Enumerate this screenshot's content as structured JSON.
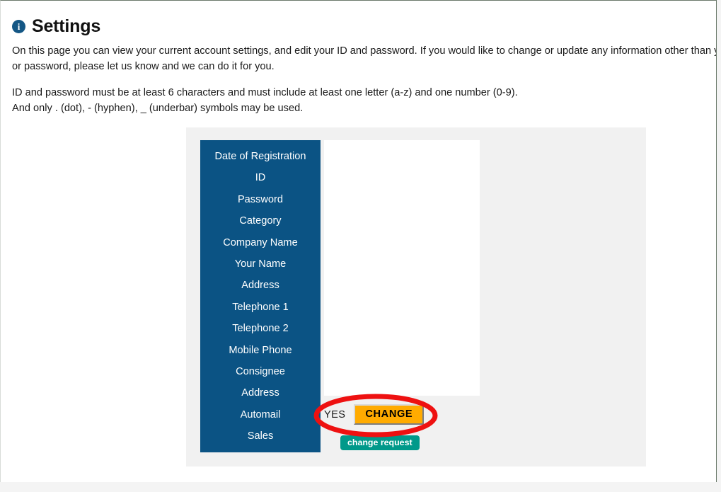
{
  "page": {
    "title": "Settings",
    "info_icon": "info-icon",
    "intro_line_1": "On this page you can view your current account settings, and edit your ID and password. If you would like to change or update any information other than you",
    "intro_line_2": "or password, please let us know and we can do it for you.",
    "rules_line_1": "ID and password must be at least 6 characters and must include at least one letter (a-z) and one number (0-9).",
    "rules_line_2": "And only . (dot), - (hyphen), _ (underbar) symbols may be used."
  },
  "settings_form": {
    "field_labels": [
      "Date of Registration",
      "ID",
      "Password",
      "Category",
      "Company Name",
      "Your Name",
      "Address",
      "Telephone 1",
      "Telephone 2",
      "Mobile Phone",
      "Consignee",
      "Address",
      "Automail",
      "Sales"
    ],
    "field_values": [
      "",
      "",
      "",
      "",
      "",
      "",
      "",
      "",
      "",
      "",
      "",
      "",
      "",
      ""
    ],
    "confirm_label": "YES",
    "change_button_label": "CHANGE",
    "status_badge_label": "change request"
  },
  "annotation": {
    "shape": "ellipse-highlight",
    "color": "#ee1111",
    "target": "CHANGE"
  },
  "colors": {
    "label_column_background": "#0b5384",
    "panel_background": "#f1f1f1",
    "value_column_background": "#ffffff",
    "change_button_background": "#ffab00",
    "status_badge_background": "#00998a",
    "info_icon_background": "#145785",
    "annotation_red": "#ee1111"
  }
}
